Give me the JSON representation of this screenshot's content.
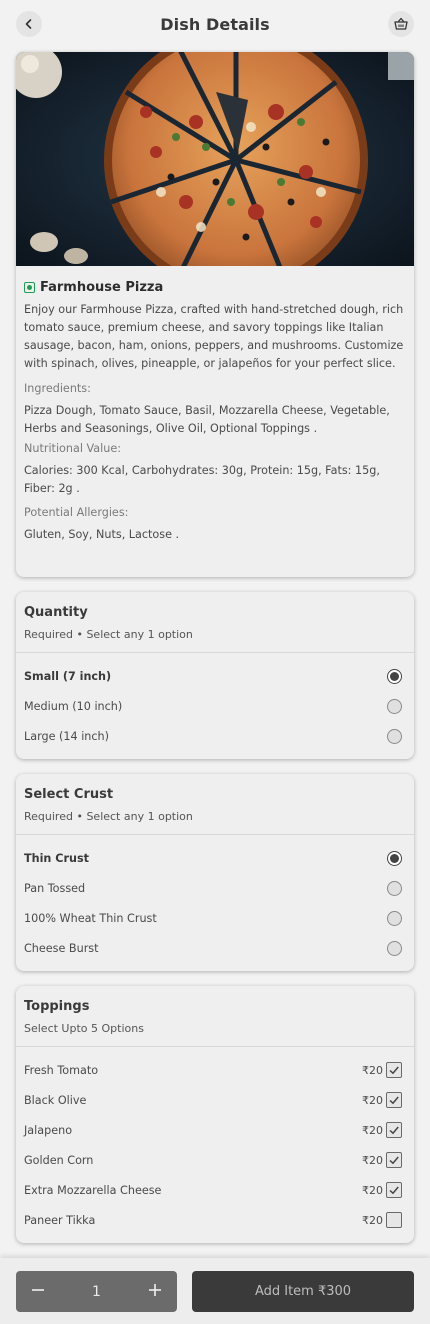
{
  "header": {
    "title": "Dish Details",
    "back_icon": "chevron-left-icon",
    "cart_icon": "basket-icon"
  },
  "dish": {
    "name": "Farmhouse Pizza",
    "veg_indicator_color": "#1f9d55",
    "description": "Enjoy our Farmhouse Pizza, crafted with hand-stretched dough, rich tomato sauce, premium cheese, and savory toppings like Italian sausage, bacon, ham, onions, peppers, and mushrooms. Customize with spinach, olives, pineapple, or jalapeños for your perfect slice.",
    "ingredients_label": "Ingredients:",
    "ingredients": "Pizza Dough, Tomato Sauce,  Basil, Mozzarella Cheese, Vegetable, Herbs and Seasonings, Olive Oil, Optional Toppings .",
    "nutrition_label": "Nutritional Value:",
    "nutrition": "Calories: 300 Kcal, Carbohydrates: 30g, Protein: 15g, Fats: 15g, Fiber: 2g .",
    "allergies_label": "Potential Allergies:",
    "allergies": "Gluten, Soy, Nuts, Lactose ."
  },
  "quantity": {
    "title": "Quantity",
    "subtitle": "Required • Select any 1 option",
    "options": [
      {
        "label": "Small (7 inch)",
        "selected": true
      },
      {
        "label": "Medium (10 inch)",
        "selected": false
      },
      {
        "label": "Large (14 inch)",
        "selected": false
      }
    ]
  },
  "crust": {
    "title": "Select Crust",
    "subtitle": "Required • Select any 1 option",
    "options": [
      {
        "label": "Thin Crust",
        "selected": true
      },
      {
        "label": "Pan Tossed",
        "selected": false
      },
      {
        "label": "100% Wheat Thin Crust",
        "selected": false
      },
      {
        "label": "Cheese Burst",
        "selected": false
      }
    ]
  },
  "toppings": {
    "title": "Toppings",
    "subtitle": "Select Upto 5 Options",
    "options": [
      {
        "label": "Fresh Tomato",
        "price": "₹20",
        "checked": true
      },
      {
        "label": "Black Olive",
        "price": "₹20",
        "checked": true
      },
      {
        "label": "Jalapeno",
        "price": "₹20",
        "checked": true
      },
      {
        "label": "Golden Corn",
        "price": "₹20",
        "checked": true
      },
      {
        "label": "Extra Mozzarella Cheese",
        "price": "₹20",
        "checked": true
      },
      {
        "label": "Paneer Tikka",
        "price": "₹20",
        "checked": false
      }
    ]
  },
  "footer": {
    "quantity": "1",
    "add_button_label": "Add Item ₹300"
  },
  "colors": {
    "background": "#f2f2f2",
    "card": "#efefef",
    "stepper": "#6b6b6b",
    "add_button": "#3a3a3a"
  }
}
